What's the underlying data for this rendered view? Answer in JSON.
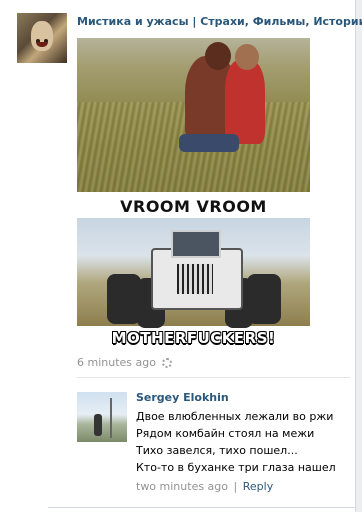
{
  "post": {
    "group_title": "Мистика и ужасы | Страхи, Фильмы, Истории",
    "image": {
      "caption_top": "VROOM VROOM",
      "caption_bottom": "MOTHERFUCKERS!"
    },
    "time": "6 minutes ago",
    "settings_icon": "gear-icon"
  },
  "comment": {
    "author": "Sergey Elokhin",
    "lines": [
      "Двое влюбленных лежали во ржи",
      "Рядом комбайн стоял на межи",
      "Тихо завелся, тихо пошел...",
      "Кто-то в буханке три глаза нашел"
    ],
    "time": "two minutes ago",
    "separator": "|",
    "reply_label": "Reply"
  },
  "colors": {
    "link": "#2b587a",
    "meta": "#939393",
    "background": "#edeef0"
  }
}
